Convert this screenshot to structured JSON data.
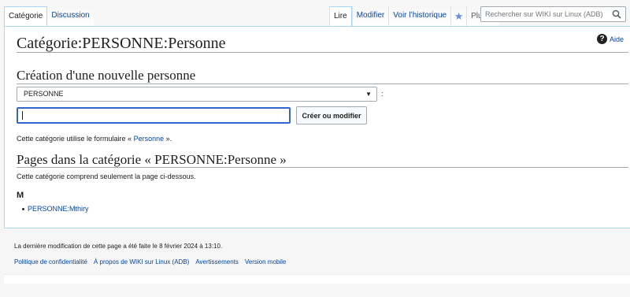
{
  "header": {
    "tabs_left": [
      "Catégorie",
      "Discussion"
    ],
    "tabs_right": {
      "read": "Lire",
      "edit": "Modifier",
      "history": "Voir l’historique",
      "more": "Plus"
    },
    "search_placeholder": "Rechercher sur WIKI sur Linux (ADB)"
  },
  "page": {
    "title": "Catégorie:PERSONNE:Personne",
    "help": "Aide"
  },
  "form": {
    "heading": "Création d'une nouvelle personne",
    "select_value": "PERSONNE",
    "colon": ":",
    "input_value": "",
    "button": "Créer ou modifier",
    "note_prefix": "Cette catégorie utilise le formulaire «",
    "note_link": "Personne",
    "note_suffix": "»."
  },
  "pages": {
    "heading": "Pages dans la catégorie « PERSONNE:Personne »",
    "description": "Cette catégorie comprend seulement la page ci-dessous.",
    "groups": [
      {
        "letter": "M",
        "items": [
          "PERSONNE:Mthiry"
        ]
      }
    ]
  },
  "footer": {
    "last_modified": "La dernière modification de cette page a été faite le 8 février 2024 à 13:10.",
    "links": [
      "Politique de confidentialité",
      "À propos de WIKI sur Linux (ADB)",
      "Avertissements",
      "Version mobile"
    ]
  }
}
